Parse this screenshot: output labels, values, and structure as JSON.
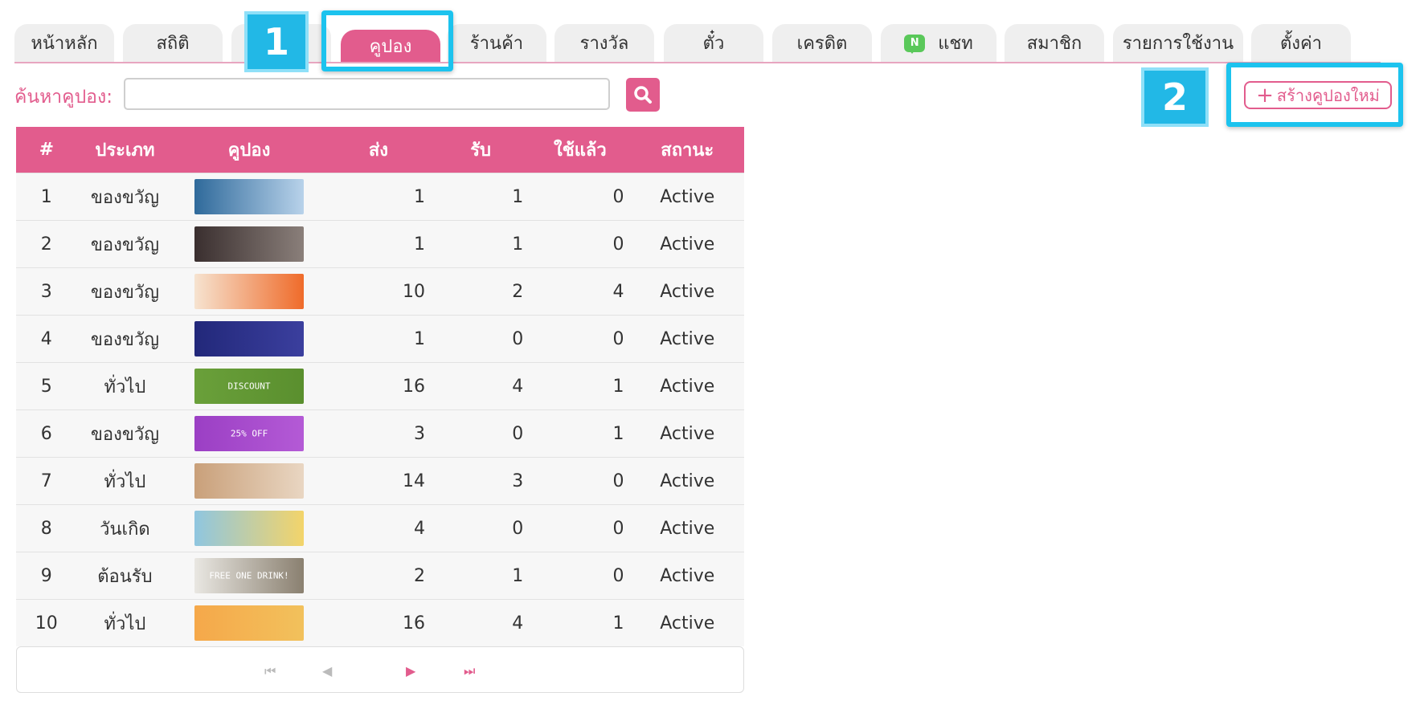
{
  "tabs": [
    {
      "label": "หน้าหลัก",
      "active": false
    },
    {
      "label": "สถิติ",
      "active": false
    },
    {
      "label": "",
      "active": false
    },
    {
      "label": "คูปอง",
      "active": true
    },
    {
      "label": "ร้านค้า",
      "active": false
    },
    {
      "label": "รางวัล",
      "active": false
    },
    {
      "label": "ตั๋ว",
      "active": false
    },
    {
      "label": "เครดิต",
      "active": false
    },
    {
      "label": "แชท",
      "active": false,
      "icon": "chat-icon"
    },
    {
      "label": "สมาชิก",
      "active": false
    },
    {
      "label": "รายการใช้งาน",
      "active": false
    },
    {
      "label": "ตั้งค่า",
      "active": false
    }
  ],
  "chat_icon_letter": "N",
  "callouts": {
    "one": "1",
    "two": "2"
  },
  "search": {
    "label": "ค้นหาคูปอง:",
    "placeholder": "",
    "value": ""
  },
  "new_coupon_button": {
    "plus": "+",
    "label": "สร้างคูปองใหม่"
  },
  "table": {
    "headers": [
      "#",
      "ประเภท",
      "คูปอง",
      "ส่ง",
      "รับ",
      "ใช้แล้ว",
      "สถานะ"
    ],
    "rows": [
      {
        "num": "1",
        "type": "ของขวัญ",
        "thumb_text": "",
        "thumb_colors": [
          "#2f6a9b",
          "#b8d2ea"
        ],
        "sent": "1",
        "received": "1",
        "used": "0",
        "status": "Active"
      },
      {
        "num": "2",
        "type": "ของขวัญ",
        "thumb_text": "",
        "thumb_colors": [
          "#3a2f2f",
          "#8a7f7a"
        ],
        "sent": "1",
        "received": "1",
        "used": "0",
        "status": "Active"
      },
      {
        "num": "3",
        "type": "ของขวัญ",
        "thumb_text": "",
        "thumb_colors": [
          "#f6e3d0",
          "#ef6b2a"
        ],
        "sent": "10",
        "received": "2",
        "used": "4",
        "status": "Active"
      },
      {
        "num": "4",
        "type": "ของขวัญ",
        "thumb_text": "",
        "thumb_colors": [
          "#22287a",
          "#3b3f9e"
        ],
        "sent": "1",
        "received": "0",
        "used": "0",
        "status": "Active"
      },
      {
        "num": "5",
        "type": "ทั่วไป",
        "thumb_text": "DISCOUNT",
        "thumb_colors": [
          "#6aa03a",
          "#5a8f2e"
        ],
        "sent": "16",
        "received": "4",
        "used": "1",
        "status": "Active"
      },
      {
        "num": "6",
        "type": "ของขวัญ",
        "thumb_text": "25% OFF",
        "thumb_colors": [
          "#9b3fc4",
          "#b45ad6"
        ],
        "sent": "3",
        "received": "0",
        "used": "1",
        "status": "Active"
      },
      {
        "num": "7",
        "type": "ทั่วไป",
        "thumb_text": "",
        "thumb_colors": [
          "#c9a07a",
          "#e9d6c2"
        ],
        "sent": "14",
        "received": "3",
        "used": "0",
        "status": "Active"
      },
      {
        "num": "8",
        "type": "วันเกิด",
        "thumb_text": "",
        "thumb_colors": [
          "#8fc6e0",
          "#f3d46a"
        ],
        "sent": "4",
        "received": "0",
        "used": "0",
        "status": "Active"
      },
      {
        "num": "9",
        "type": "ต้อนรับ",
        "thumb_text": "FREE ONE DRINK!",
        "thumb_colors": [
          "#e9e7e2",
          "#8a8070"
        ],
        "sent": "2",
        "received": "1",
        "used": "0",
        "status": "Active"
      },
      {
        "num": "10",
        "type": "ทั่วไป",
        "thumb_text": "",
        "thumb_colors": [
          "#f5a84a",
          "#f2c15c"
        ],
        "sent": "16",
        "received": "4",
        "used": "1",
        "status": "Active"
      }
    ]
  },
  "pagination": {
    "first": "⏮",
    "prev": "◀",
    "next": "▶",
    "last": "⏭"
  },
  "colors": {
    "accent": "#e25c8d",
    "callout": "#22b8e6"
  }
}
